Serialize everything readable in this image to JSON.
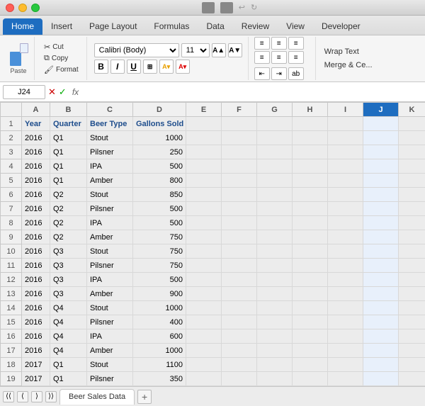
{
  "window": {
    "title": "Beer Sales Data"
  },
  "tabs": [
    {
      "label": "Home",
      "active": true
    },
    {
      "label": "Insert"
    },
    {
      "label": "Page Layout"
    },
    {
      "label": "Formulas"
    },
    {
      "label": "Data"
    },
    {
      "label": "Review"
    },
    {
      "label": "View"
    },
    {
      "label": "Developer"
    }
  ],
  "ribbon": {
    "paste_label": "Paste",
    "cut_label": "Cut",
    "copy_label": "Copy",
    "format_label": "Format",
    "font_name": "Calibri (Body)",
    "font_size": "11",
    "bold": "B",
    "italic": "I",
    "underline": "U",
    "wrap_text": "Wrap Text",
    "merge_label": "Merge & Ce..."
  },
  "formula_bar": {
    "cell_ref": "J24",
    "fx": "fx"
  },
  "columns": [
    "",
    "A",
    "B",
    "C",
    "D",
    "E",
    "F",
    "G",
    "H",
    "I",
    "J",
    "K"
  ],
  "header_row": [
    "",
    "Year",
    "Quarter",
    "Beer Type",
    "Gallons Sold",
    "",
    "",
    "",
    "",
    "",
    "",
    ""
  ],
  "rows": [
    {
      "row": 2,
      "a": "2016",
      "b": "Q1",
      "c": "Stout",
      "d": "1000"
    },
    {
      "row": 3,
      "a": "2016",
      "b": "Q1",
      "c": "Pilsner",
      "d": "250"
    },
    {
      "row": 4,
      "a": "2016",
      "b": "Q1",
      "c": "IPA",
      "d": "500"
    },
    {
      "row": 5,
      "a": "2016",
      "b": "Q1",
      "c": "Amber",
      "d": "800"
    },
    {
      "row": 6,
      "a": "2016",
      "b": "Q2",
      "c": "Stout",
      "d": "850"
    },
    {
      "row": 7,
      "a": "2016",
      "b": "Q2",
      "c": "Pilsner",
      "d": "500"
    },
    {
      "row": 8,
      "a": "2016",
      "b": "Q2",
      "c": "IPA",
      "d": "500"
    },
    {
      "row": 9,
      "a": "2016",
      "b": "Q2",
      "c": "Amber",
      "d": "750"
    },
    {
      "row": 10,
      "a": "2016",
      "b": "Q3",
      "c": "Stout",
      "d": "750"
    },
    {
      "row": 11,
      "a": "2016",
      "b": "Q3",
      "c": "Pilsner",
      "d": "750"
    },
    {
      "row": 12,
      "a": "2016",
      "b": "Q3",
      "c": "IPA",
      "d": "500"
    },
    {
      "row": 13,
      "a": "2016",
      "b": "Q3",
      "c": "Amber",
      "d": "900"
    },
    {
      "row": 14,
      "a": "2016",
      "b": "Q4",
      "c": "Stout",
      "d": "1000"
    },
    {
      "row": 15,
      "a": "2016",
      "b": "Q4",
      "c": "Pilsner",
      "d": "400"
    },
    {
      "row": 16,
      "a": "2016",
      "b": "Q4",
      "c": "IPA",
      "d": "600"
    },
    {
      "row": 17,
      "a": "2016",
      "b": "Q4",
      "c": "Amber",
      "d": "1000"
    },
    {
      "row": 18,
      "a": "2017",
      "b": "Q1",
      "c": "Stout",
      "d": "1100"
    },
    {
      "row": 19,
      "a": "2017",
      "b": "Q1",
      "c": "Pilsner",
      "d": "350"
    }
  ],
  "sheet_tab": "Beer Sales Data",
  "accent_color": "#1e6dc0"
}
